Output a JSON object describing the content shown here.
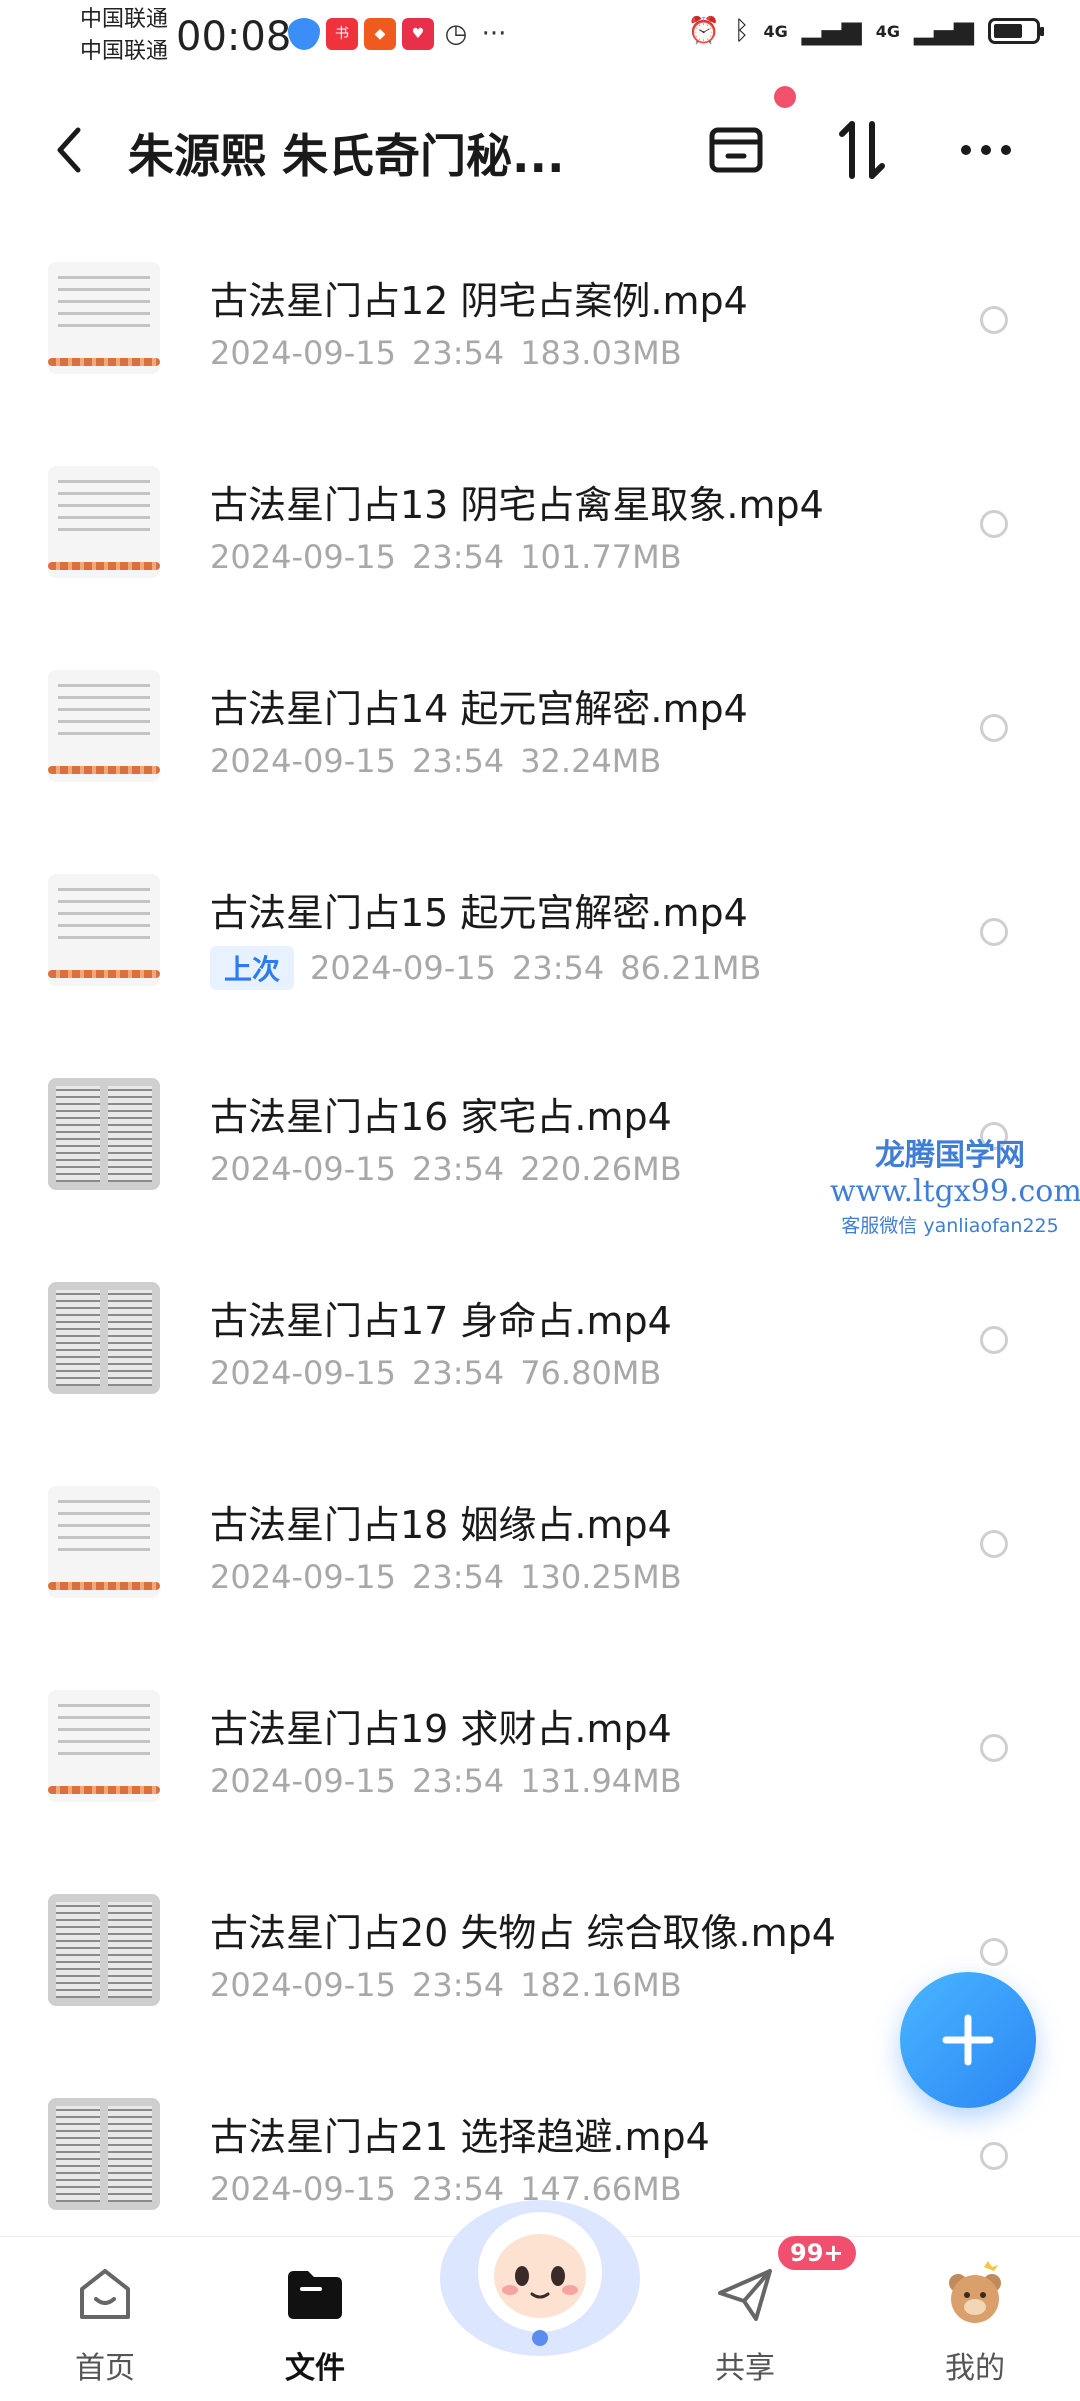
{
  "status_bar": {
    "carrier1": "中国联通",
    "carrier2": "中国联通",
    "time": "00:08",
    "net1": "4G",
    "net2": "4G",
    "battery_level": 0.7,
    "app_icons": [
      "shield-icon",
      "xiaohongshu-icon",
      "app-icon",
      "heart-app-icon",
      "alarm-icon"
    ]
  },
  "header": {
    "back_icon": "chevron-left-icon",
    "title": "朱源熙 朱氏奇门秘...",
    "actions": [
      "select-all-icon",
      "sort-icon",
      "more-icon"
    ]
  },
  "files": [
    {
      "name": "古法星门占12 阴宅占案例.mp4",
      "date": "2024-09-15",
      "time": "23:54",
      "size": "183.03MB",
      "badge": ""
    },
    {
      "name": "古法星门占13 阴宅占禽星取象.mp4",
      "date": "2024-09-15",
      "time": "23:54",
      "size": "101.77MB",
      "badge": ""
    },
    {
      "name": "古法星门占14 起元宫解密.mp4",
      "date": "2024-09-15",
      "time": "23:54",
      "size": "32.24MB",
      "badge": ""
    },
    {
      "name": "古法星门占15 起元宫解密.mp4",
      "date": "2024-09-15",
      "time": "23:54",
      "size": "86.21MB",
      "badge": "上次"
    },
    {
      "name": "古法星门占16 家宅占.mp4",
      "date": "2024-09-15",
      "time": "23:54",
      "size": "220.26MB",
      "badge": ""
    },
    {
      "name": "古法星门占17 身命占.mp4",
      "date": "2024-09-15",
      "time": "23:54",
      "size": "76.80MB",
      "badge": ""
    },
    {
      "name": "古法星门占18 姻缘占.mp4",
      "date": "2024-09-15",
      "time": "23:54",
      "size": "130.25MB",
      "badge": ""
    },
    {
      "name": "古法星门占19 求财占.mp4",
      "date": "2024-09-15",
      "time": "23:54",
      "size": "131.94MB",
      "badge": ""
    },
    {
      "name": "古法星门占20 失物占  综合取像.mp4",
      "date": "2024-09-15",
      "time": "23:54",
      "size": "182.16MB",
      "badge": ""
    },
    {
      "name": "古法星门占21 选择趋避.mp4",
      "date": "2024-09-15",
      "time": "23:54",
      "size": "147.66MB",
      "badge": ""
    }
  ],
  "watermark": {
    "line1": "龙腾国学网",
    "line2": "www.ltgx99.com",
    "line3": "客服微信 yanliaofan225"
  },
  "bottom_nav": {
    "home": "首页",
    "files": "文件",
    "share": "共享",
    "mine": "我的",
    "share_badge": "99+"
  },
  "colors": {
    "accent": "#2b86f5",
    "badge_red": "#f0506e",
    "meta_gray": "#a8a8a8"
  }
}
